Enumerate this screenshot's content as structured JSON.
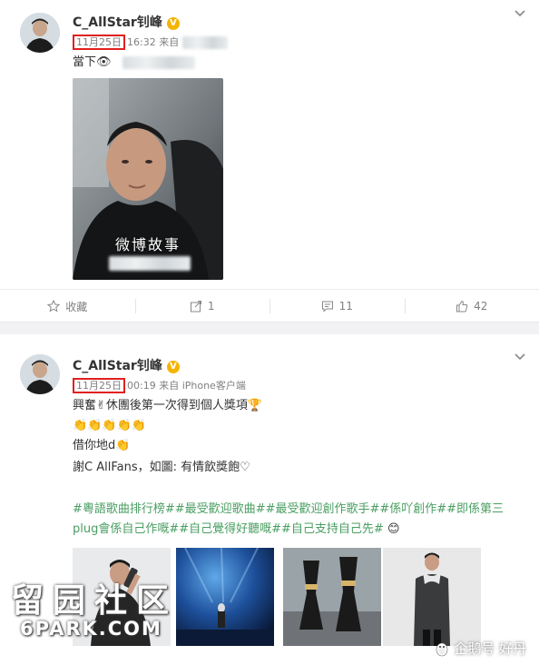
{
  "post1": {
    "username": "C_AllStar钊峰",
    "date": "11月25日",
    "time": "16:32",
    "source_prefix": "来自",
    "content": "當下👁",
    "photo_watermark": "微博故事",
    "actions": {
      "collect_label": "收藏",
      "share_count": "1",
      "comment_count": "11",
      "like_count": "42"
    }
  },
  "post2": {
    "username": "C_AllStar钊峰",
    "date": "11月25日",
    "time": "00:19",
    "source": "来自 iPhone客户端",
    "lines": [
      "興奮✌休團後第一次得到個人獎項🏆",
      "👏👏👏👏👏",
      "借你地d👏",
      "謝C AllFans，如圖: 有情飲獎飽♡"
    ],
    "hashtags_line1": "#粵語歌曲排行榜##最受歡迎歌曲##最受歡迎創作歌手##係吖創作##即係第三",
    "hashtags_line2": "plug會係自己作嘅##自己覺得好聽嘅##自己支持自己先#",
    "emoji_end": "😊"
  },
  "watermarks": {
    "site_cn": "留园社区",
    "site_en": "6PARK.COM",
    "platform": "企鹅号 好丹"
  },
  "colors": {
    "highlight_box": "#e02020",
    "hashtag": "#4a9e62",
    "verified_badge": "#f4b400"
  }
}
